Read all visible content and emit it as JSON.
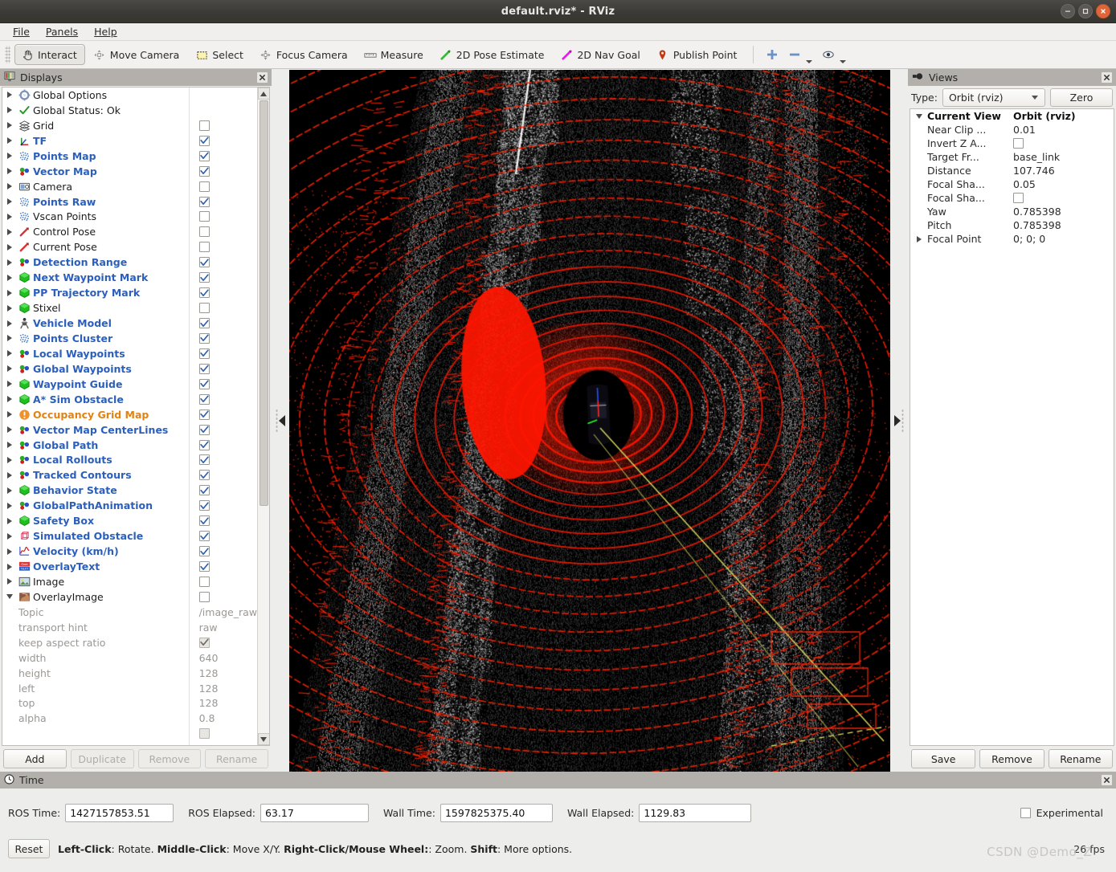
{
  "window": {
    "title": "default.rviz* - RViz",
    "buttons": [
      {
        "name": "minimize-button",
        "glyph": "–"
      },
      {
        "name": "maximize-button",
        "glyph": "□"
      },
      {
        "name": "close-button",
        "glyph": "×"
      }
    ]
  },
  "menubar": {
    "items": [
      "File",
      "Panels",
      "Help"
    ]
  },
  "toolbar": {
    "items": [
      {
        "label": "Interact",
        "icon": "hand-cursor-icon",
        "active": true
      },
      {
        "label": "Move Camera",
        "icon": "move-camera-icon",
        "active": false
      },
      {
        "label": "Select",
        "icon": "select-rect-icon",
        "active": false
      },
      {
        "label": "Focus Camera",
        "icon": "focus-camera-icon",
        "active": false
      },
      {
        "label": "Measure",
        "icon": "ruler-icon",
        "active": false
      },
      {
        "label": "2D Pose Estimate",
        "icon": "green-arrow-icon",
        "active": false
      },
      {
        "label": "2D Nav Goal",
        "icon": "magenta-arrow-icon",
        "active": false
      },
      {
        "label": "Publish Point",
        "icon": "map-pin-icon",
        "active": false
      }
    ],
    "extra": [
      {
        "name": "add-tool-button",
        "icon": "plus-icon"
      },
      {
        "name": "remove-tool-button",
        "icon": "minus-icon"
      },
      {
        "name": "tool-visibility-button",
        "icon": "eye-icon"
      }
    ]
  },
  "displays": {
    "panel_title": "Displays",
    "panel_icon": "displays-icon",
    "close_icon": "close-icon",
    "rows": [
      {
        "label": "Global Options",
        "icon": "gear-icon",
        "style": "plain",
        "check": null,
        "expandable": true
      },
      {
        "label": "Global Status: Ok",
        "icon": "check-icon",
        "style": "plain",
        "check": null,
        "expandable": true
      },
      {
        "label": "Grid",
        "icon": "grid-icon",
        "style": "plain",
        "check": false,
        "expandable": true
      },
      {
        "label": "TF",
        "icon": "tf-axes-icon",
        "style": "link",
        "check": true,
        "expandable": true
      },
      {
        "label": "Points Map",
        "icon": "pointcloud-icon",
        "style": "link",
        "check": true,
        "expandable": true
      },
      {
        "label": "Vector Map",
        "icon": "markerarray-icon",
        "style": "link",
        "check": true,
        "expandable": true
      },
      {
        "label": "Camera",
        "icon": "camera-icon",
        "style": "plain",
        "check": false,
        "expandable": true
      },
      {
        "label": "Points Raw",
        "icon": "pointcloud-icon",
        "style": "link",
        "check": true,
        "expandable": true
      },
      {
        "label": "Vscan Points",
        "icon": "pointcloud-icon",
        "style": "plain",
        "check": false,
        "expandable": true
      },
      {
        "label": "Control Pose",
        "icon": "pose-arrow-icon",
        "style": "plain",
        "check": false,
        "expandable": true
      },
      {
        "label": "Current Pose",
        "icon": "pose-arrow-icon",
        "style": "plain",
        "check": false,
        "expandable": true
      },
      {
        "label": "Detection Range",
        "icon": "markerarray-icon",
        "style": "link",
        "check": true,
        "expandable": true
      },
      {
        "label": "Next Waypoint Mark",
        "icon": "marker-cube-icon",
        "style": "link",
        "check": true,
        "expandable": true
      },
      {
        "label": "PP Trajectory Mark",
        "icon": "marker-cube-icon",
        "style": "link",
        "check": true,
        "expandable": true
      },
      {
        "label": "Stixel",
        "icon": "marker-cube-icon",
        "style": "plain",
        "check": false,
        "expandable": true
      },
      {
        "label": "Vehicle Model",
        "icon": "robot-model-icon",
        "style": "link",
        "check": true,
        "expandable": true
      },
      {
        "label": "Points Cluster",
        "icon": "pointcloud-icon",
        "style": "link",
        "check": true,
        "expandable": true
      },
      {
        "label": "Local Waypoints",
        "icon": "markerarray-icon",
        "style": "link",
        "check": true,
        "expandable": true
      },
      {
        "label": "Global Waypoints",
        "icon": "markerarray-icon",
        "style": "link",
        "check": true,
        "expandable": true
      },
      {
        "label": "Waypoint Guide",
        "icon": "marker-cube-icon",
        "style": "link",
        "check": true,
        "expandable": true
      },
      {
        "label": "A* Sim Obstacle",
        "icon": "marker-cube-icon",
        "style": "link",
        "check": true,
        "expandable": true
      },
      {
        "label": "Occupancy Grid Map",
        "icon": "warning-icon",
        "style": "warn",
        "check": true,
        "expandable": true
      },
      {
        "label": "Vector Map CenterLines",
        "icon": "markerarray-icon",
        "style": "link",
        "check": true,
        "expandable": true
      },
      {
        "label": "Global Path",
        "icon": "markerarray-icon",
        "style": "link",
        "check": true,
        "expandable": true
      },
      {
        "label": "Local Rollouts",
        "icon": "markerarray-icon",
        "style": "link",
        "check": true,
        "expandable": true
      },
      {
        "label": "Tracked Contours",
        "icon": "markerarray-icon",
        "style": "link",
        "check": true,
        "expandable": true
      },
      {
        "label": "Behavior State",
        "icon": "marker-cube-icon",
        "style": "link",
        "check": true,
        "expandable": true
      },
      {
        "label": "GlobalPathAnimation",
        "icon": "markerarray-icon",
        "style": "link",
        "check": true,
        "expandable": true
      },
      {
        "label": "Safety Box",
        "icon": "marker-cube-icon",
        "style": "link",
        "check": true,
        "expandable": true
      },
      {
        "label": "Simulated Obstacle",
        "icon": "wire-cube-icon",
        "style": "link",
        "check": true,
        "expandable": true
      },
      {
        "label": "Velocity (km/h)",
        "icon": "plotter-icon",
        "style": "link",
        "check": true,
        "expandable": true
      },
      {
        "label": "OverlayText",
        "icon": "overlaytext-icon",
        "style": "link",
        "check": true,
        "expandable": true
      },
      {
        "label": "Image",
        "icon": "image-icon",
        "style": "plain",
        "check": false,
        "expandable": true
      },
      {
        "label": "OverlayImage",
        "icon": "overlayimage-icon",
        "style": "plain",
        "check": false,
        "expandable": true,
        "expanded": true
      }
    ],
    "properties": [
      {
        "label": "Topic",
        "value": "/image_raw",
        "type": "text"
      },
      {
        "label": "transport hint",
        "value": "raw",
        "type": "text"
      },
      {
        "label": "keep aspect ratio",
        "value": "",
        "type": "check",
        "checked": true
      },
      {
        "label": "width",
        "value": "640",
        "type": "text"
      },
      {
        "label": "height",
        "value": "128",
        "type": "text"
      },
      {
        "label": "left",
        "value": "128",
        "type": "text"
      },
      {
        "label": "top",
        "value": "128",
        "type": "text"
      },
      {
        "label": "alpha",
        "value": "0.8",
        "type": "text"
      }
    ],
    "buttons": [
      {
        "label": "Add",
        "enabled": true
      },
      {
        "label": "Duplicate",
        "enabled": false
      },
      {
        "label": "Remove",
        "enabled": false
      },
      {
        "label": "Rename",
        "enabled": false
      }
    ]
  },
  "views": {
    "panel_title": "Views",
    "panel_icon": "views-icon",
    "close_icon": "close-icon",
    "type_label": "Type:",
    "type_value": "Orbit (rviz)",
    "zero_label": "Zero",
    "rows": [
      {
        "key": "Current View",
        "value": "Orbit (rviz)",
        "type": "header",
        "expandable": true
      },
      {
        "key": "Near Clip ...",
        "value": "0.01",
        "type": "text"
      },
      {
        "key": "Invert Z A...",
        "value": "",
        "type": "check",
        "checked": false
      },
      {
        "key": "Target Fr...",
        "value": "base_link",
        "type": "text"
      },
      {
        "key": "Distance",
        "value": "107.746",
        "type": "text"
      },
      {
        "key": "Focal Sha...",
        "value": "0.05",
        "type": "text"
      },
      {
        "key": "Focal Sha...",
        "value": "",
        "type": "check",
        "checked": false
      },
      {
        "key": "Yaw",
        "value": "0.785398",
        "type": "text"
      },
      {
        "key": "Pitch",
        "value": "0.785398",
        "type": "text"
      },
      {
        "key": "Focal Point",
        "value": "0; 0; 0",
        "type": "text",
        "expandable": true
      }
    ],
    "buttons": [
      {
        "label": "Save"
      },
      {
        "label": "Remove"
      },
      {
        "label": "Rename"
      }
    ]
  },
  "time": {
    "panel_title": "Time",
    "panel_icon": "clock-icon",
    "close_icon": "close-icon",
    "fields": [
      {
        "label": "ROS Time:",
        "value": "1427157853.51"
      },
      {
        "label": "ROS Elapsed:",
        "value": "63.17"
      },
      {
        "label": "Wall Time:",
        "value": "1597825375.40"
      },
      {
        "label": "Wall Elapsed:",
        "value": "1129.83"
      }
    ],
    "experimental_label": "Experimental",
    "experimental_checked": false
  },
  "statusbar": {
    "reset_label": "Reset",
    "hint_parts": [
      {
        "text": "Left-Click",
        "bold": true
      },
      {
        "text": ": Rotate.  ",
        "bold": false
      },
      {
        "text": "Middle-Click",
        "bold": true
      },
      {
        "text": ": Move X/Y.  ",
        "bold": false
      },
      {
        "text": "Right-Click/Mouse Wheel:",
        "bold": true
      },
      {
        "text": ": Zoom.  ",
        "bold": false
      },
      {
        "text": "Shift",
        "bold": true
      },
      {
        "text": ": More options.",
        "bold": false
      }
    ],
    "fps": "26 fps",
    "watermark": "CSDN @Demo_Z"
  },
  "view3d": {
    "background": "#000000",
    "scan_ring_color": "#ff1500",
    "pointcloud_color": "#c8c8c8",
    "path_color": "#d8d860"
  }
}
